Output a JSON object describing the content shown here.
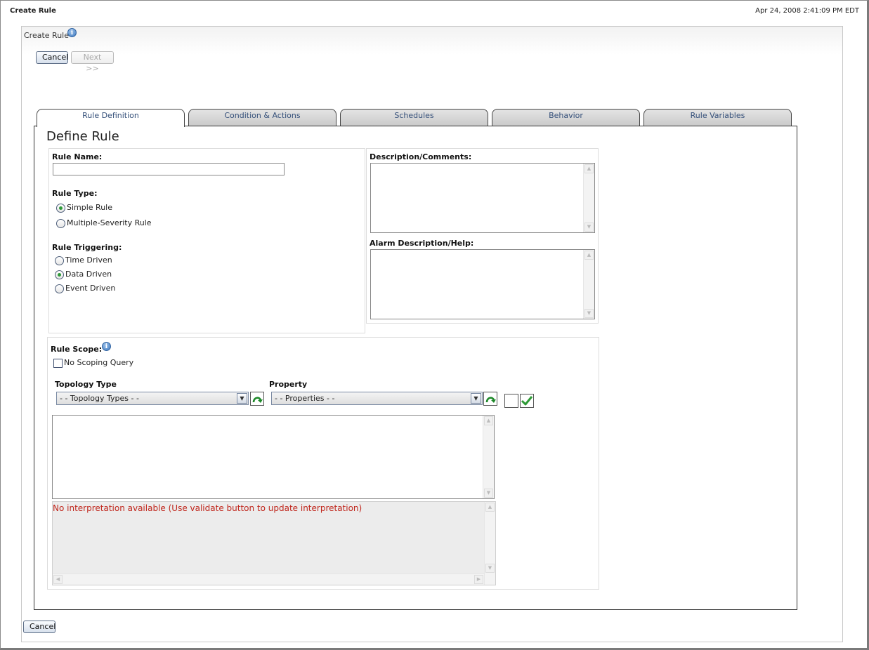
{
  "window": {
    "title": "Create Rule",
    "timestamp": "Apr 24, 2008 2:41:09 PM EDT"
  },
  "panel": {
    "title": "Create Rule",
    "cancel_label": "Cancel",
    "next_label": "Next >>",
    "bottom_cancel_label": "Cancel"
  },
  "tabs": [
    {
      "label": "Rule Definition",
      "active": true
    },
    {
      "label": "Condition & Actions",
      "active": false
    },
    {
      "label": "Schedules",
      "active": false
    },
    {
      "label": "Behavior",
      "active": false
    },
    {
      "label": "Rule Variables",
      "active": false
    }
  ],
  "define": {
    "title": "Define Rule",
    "rule_name_label": "Rule Name:",
    "rule_name_value": "",
    "rule_type_label": "Rule Type:",
    "rule_type_options": [
      {
        "label": "Simple Rule",
        "selected": true
      },
      {
        "label": "Multiple-Severity Rule",
        "selected": false
      }
    ],
    "triggering_label": "Rule Triggering:",
    "triggering_options": [
      {
        "label": "Time Driven",
        "selected": false
      },
      {
        "label": "Data Driven",
        "selected": true
      },
      {
        "label": "Event Driven",
        "selected": false
      }
    ],
    "description_label": "Description/Comments:",
    "description_value": "",
    "alarm_label": "Alarm Description/Help:",
    "alarm_value": ""
  },
  "scope": {
    "label": "Rule Scope:",
    "no_scoping_label": "No Scoping Query",
    "no_scoping_checked": false,
    "topology_label": "Topology Type",
    "topology_selected": "- - Topology Types - -",
    "property_label": "Property",
    "property_selected": "- - Properties - -",
    "query_value": "",
    "interpretation": "No interpretation available (Use validate button to update interpretation)"
  },
  "icons": {
    "info": "info-icon",
    "insert": "green-arrow-insert-icon",
    "validate": "green-checkmark-icon"
  },
  "colors": {
    "error_text": "#c0261c",
    "tab_text": "#35507a"
  }
}
